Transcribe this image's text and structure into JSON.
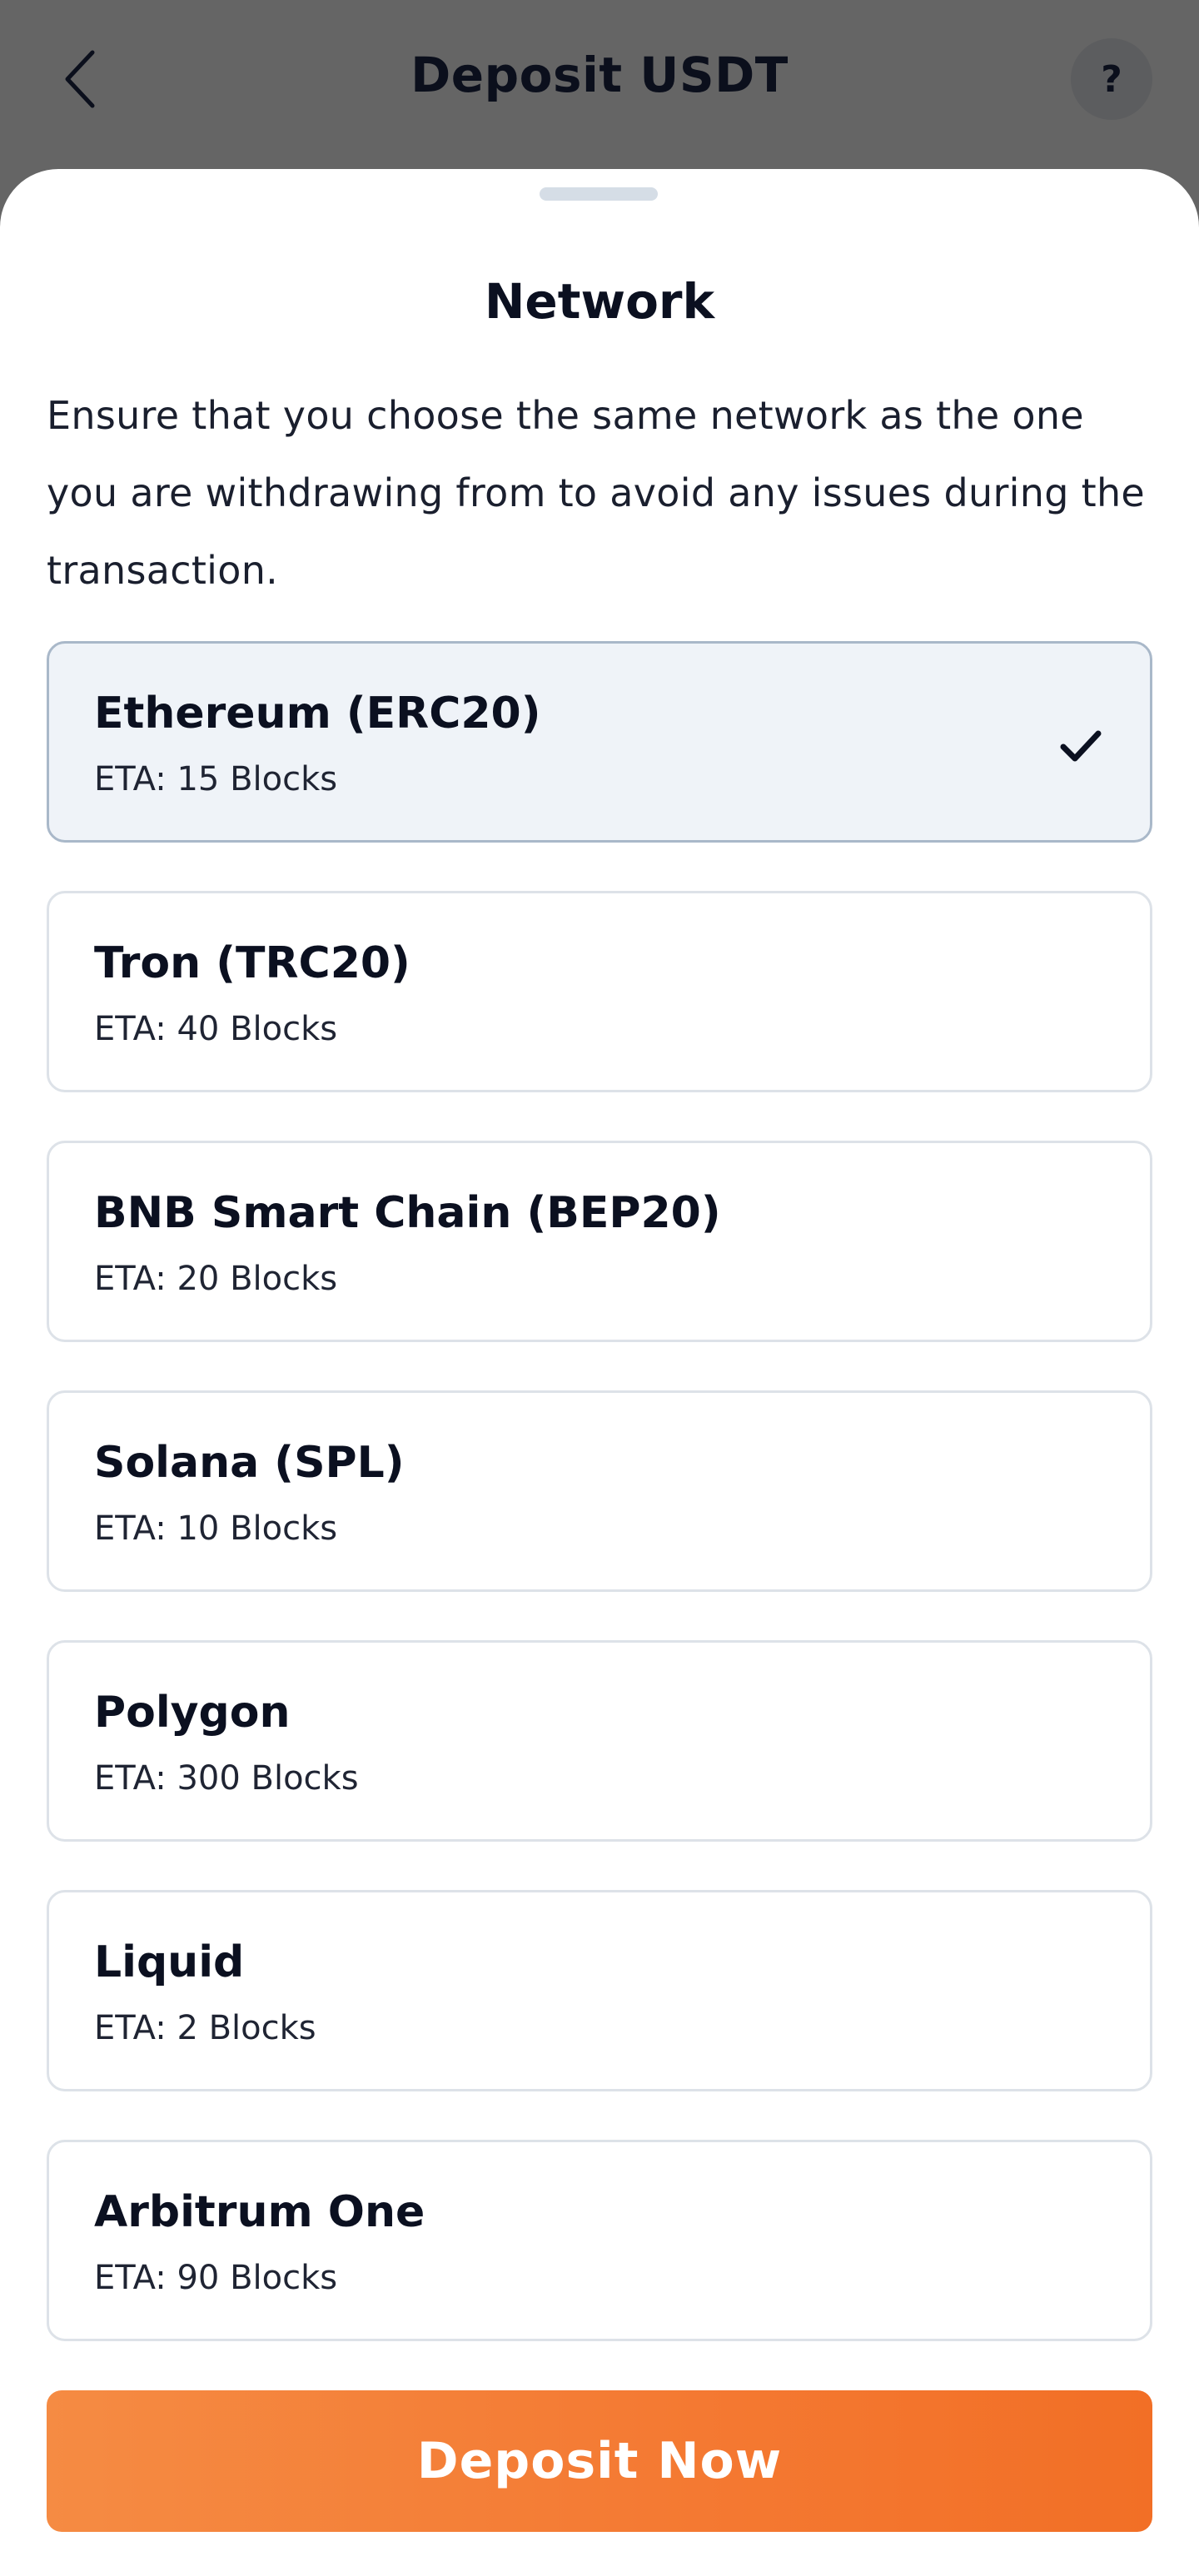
{
  "header": {
    "title": "Deposit USDT",
    "help_label": "?",
    "back_icon": "chevron-left-icon"
  },
  "sheet": {
    "title": "Network",
    "description": "Ensure that you choose the same network as the one you are withdrawing from to avoid any issues during the transaction.",
    "networks": [
      {
        "name": "Ethereum (ERC20)",
        "eta": "ETA: 15 Blocks",
        "selected": true
      },
      {
        "name": "Tron (TRC20)",
        "eta": "ETA: 40 Blocks",
        "selected": false
      },
      {
        "name": "BNB Smart Chain (BEP20)",
        "eta": "ETA: 20 Blocks",
        "selected": false
      },
      {
        "name": "Solana (SPL)",
        "eta": "ETA: 10 Blocks",
        "selected": false
      },
      {
        "name": "Polygon",
        "eta": "ETA: 300 Blocks",
        "selected": false
      },
      {
        "name": "Liquid",
        "eta": "ETA: 2 Blocks",
        "selected": false
      },
      {
        "name": "Arbitrum One",
        "eta": "ETA: 90 Blocks",
        "selected": false
      }
    ],
    "deposit_button_label": "Deposit Now"
  },
  "colors": {
    "accent": "#f47a33",
    "overlay": "#656565",
    "selected_bg": "#eff3f8"
  }
}
